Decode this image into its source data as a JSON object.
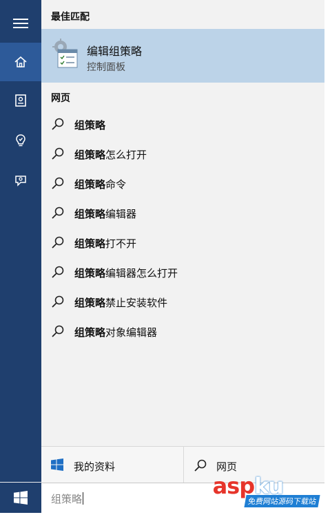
{
  "rail": {
    "items": [
      "menu",
      "home",
      "notebook",
      "reminders",
      "feedback"
    ],
    "active_index": 1,
    "colors": {
      "bg": "#1f3f6e",
      "active": "#2d5a99"
    }
  },
  "best_match": {
    "header": "最佳匹配",
    "title": "编辑组策略",
    "subtitle": "控制面板",
    "icon": "group-policy-settings-icon"
  },
  "web": {
    "header": "网页",
    "results": [
      {
        "bold": "组策略",
        "rest": ""
      },
      {
        "bold": "组策略",
        "rest": "怎么打开"
      },
      {
        "bold": "组策略",
        "rest": "命令"
      },
      {
        "bold": "组策略",
        "rest": "编辑器"
      },
      {
        "bold": "组策略",
        "rest": "打不开"
      },
      {
        "bold": "组策略",
        "rest": "编辑器怎么打开"
      },
      {
        "bold": "组策略",
        "rest": "禁止安装软件"
      },
      {
        "bold": "组策略",
        "rest": "对象编辑器"
      }
    ]
  },
  "filters": {
    "mine_label": "我的资料",
    "web_label": "网页"
  },
  "search": {
    "query": "组策略"
  },
  "watermark": {
    "logo_main": "asp",
    "logo_ku": "ku",
    "logo_dot": ".com",
    "slogan": "免费网站源码下载站"
  }
}
